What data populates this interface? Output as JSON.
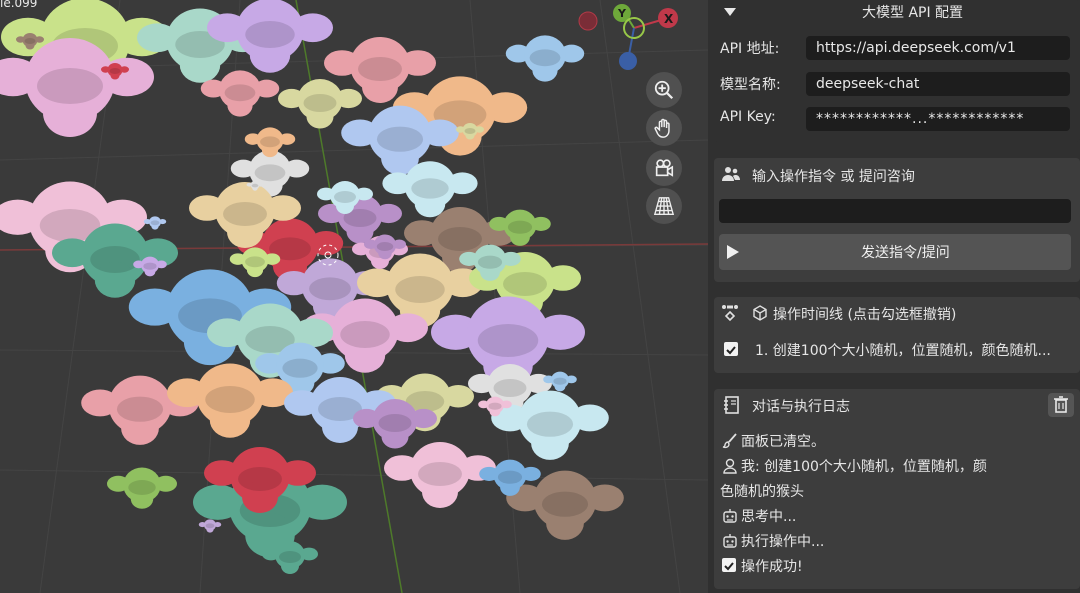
{
  "viewport": {
    "object_label": "ie.099",
    "gizmo": {
      "x": "X",
      "y": "Y"
    },
    "nav_buttons": [
      "zoom-icon",
      "hand-pan-icon",
      "camera-icon",
      "grid-perspective-icon"
    ]
  },
  "colors": {
    "accent_x": "#c0394a",
    "accent_y": "#6ea83a",
    "accent_z": "#3a5fa6",
    "panel_bg": "#3d3d3d",
    "field_bg": "#1d1d1d"
  },
  "llm_config": {
    "title": "大模型 API 配置",
    "api_url_label": "API 地址:",
    "api_url_value": "https://api.deepseek.com/v1",
    "model_label": "模型名称:",
    "model_value": "deepseek-chat",
    "key_label": "API Key:",
    "key_value": "************...************"
  },
  "command": {
    "title": "输入操作指令 或 提问咨询",
    "input_value": "",
    "send_label": "发送指令/提问"
  },
  "timeline": {
    "title": "操作时间线 (点击勾选框撤销)",
    "items": [
      {
        "text": "1. 创建100个大小随机，位置随机，颜色随机...",
        "checked": true
      }
    ]
  },
  "log": {
    "title": "对话与执行日志",
    "lines": [
      "面板已清空。",
      "我: 创建100个大小随机，位置随机，颜",
      "色随机的猴头",
      "思考中...",
      "执行操作中...",
      "操作成功!"
    ]
  }
}
